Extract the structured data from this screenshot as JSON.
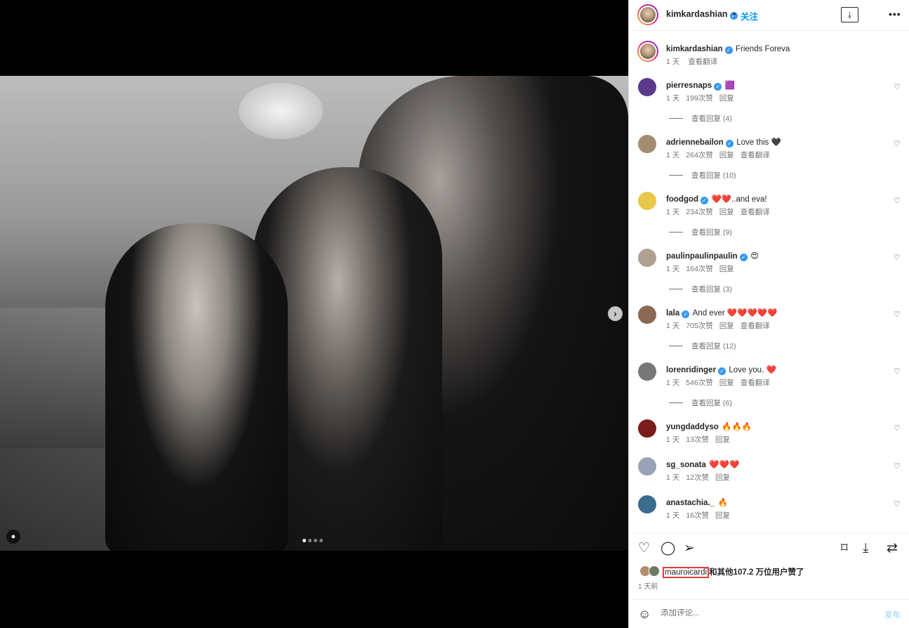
{
  "post": {
    "author": "kimkardashian",
    "follow_label": "关注",
    "dot": "•",
    "more_label": "•••",
    "download_icon": "download-icon",
    "media": {
      "next_label": "›",
      "carousel_count": 4,
      "active_index": 0
    }
  },
  "caption": {
    "user": "kimkardashian",
    "text": "Friends Foreva",
    "age": "1 天",
    "translate": "查看翻译"
  },
  "comments": [
    {
      "user": "pierresnaps",
      "verified": true,
      "text": "🟪",
      "age": "1 天",
      "likes": "199次赞",
      "reply": "回复",
      "translate": "",
      "replies": "查看回复 (4)",
      "avatar_color": "#5b3a8c"
    },
    {
      "user": "adriennebailon",
      "verified": true,
      "text": "Love this 🖤",
      "age": "1 天",
      "likes": "264次赞",
      "reply": "回复",
      "translate": "查看翻译",
      "replies": "查看回复 (10)",
      "avatar_color": "#a58c6f"
    },
    {
      "user": "foodgod",
      "verified": true,
      "text": "❤️❤️..and eva!",
      "age": "1 天",
      "likes": "234次赞",
      "reply": "回复",
      "translate": "查看翻译",
      "replies": "查看回复 (9)",
      "avatar_color": "#e8c84a"
    },
    {
      "user": "paulinpaulinpaulin",
      "verified": true,
      "text": "😍",
      "age": "1 天",
      "likes": "164次赞",
      "reply": "回复",
      "translate": "",
      "replies": "查看回复 (3)",
      "avatar_color": "#b0a090"
    },
    {
      "user": "lala",
      "verified": true,
      "text": "And ever ❤️❤️❤️❤️❤️",
      "age": "1 天",
      "likes": "705次赞",
      "reply": "回复",
      "translate": "查看翻译",
      "replies": "查看回复 (12)",
      "avatar_color": "#8a6a55"
    },
    {
      "user": "lorenridinger",
      "verified": true,
      "text": "Love you. ❤️",
      "age": "1 天",
      "likes": "546次赞",
      "reply": "回复",
      "translate": "查看翻译",
      "replies": "查看回复 (6)",
      "avatar_color": "#777777"
    },
    {
      "user": "yungdaddyso",
      "verified": false,
      "text": "🔥🔥🔥",
      "age": "1 天",
      "likes": "13次赞",
      "reply": "回复",
      "translate": "",
      "replies": "",
      "avatar_color": "#7a1c1c"
    },
    {
      "user": "sg_sonata",
      "verified": false,
      "text": "❤️❤️❤️",
      "age": "1 天",
      "likes": "12次赞",
      "reply": "回复",
      "translate": "",
      "replies": "",
      "avatar_color": "#9aa3b5"
    },
    {
      "user": "anastachia._",
      "verified": false,
      "text": "🔥",
      "age": "1 天",
      "likes": "16次赞",
      "reply": "回复",
      "translate": "",
      "replies": "",
      "avatar_color": "#3a6c8c"
    }
  ],
  "likes": {
    "highlight_user": "mauroicardi",
    "rest_text": "和其他107.2 万位用户赞了"
  },
  "time": "1 天前",
  "add_comment": {
    "placeholder": "添加评论...",
    "post_label": "发布"
  },
  "actions": {
    "like_icon": "heart-icon",
    "comment_icon": "comment-icon",
    "share_icon": "share-icon",
    "save_icon": "bookmark-icon",
    "download_icon": "download-icon",
    "remix_icon": "repost-icon"
  }
}
